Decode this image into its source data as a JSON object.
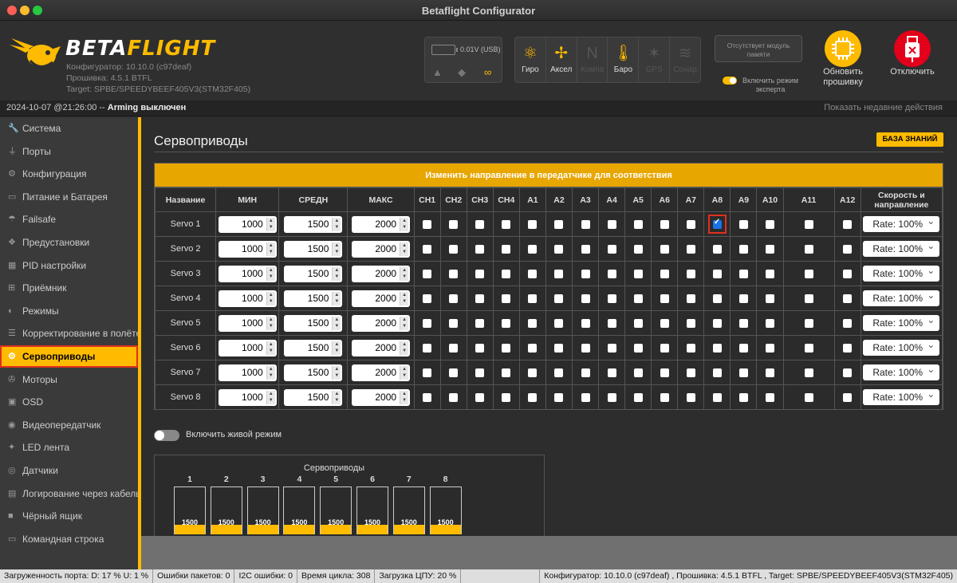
{
  "window": {
    "title": "Betaflight Configurator"
  },
  "header": {
    "logo_main": "BETA",
    "logo_accent": "FLIGHT",
    "configurator_version": "Конфигуратор: 10.10.0 (c97deaf)",
    "firmware_version": "Прошивка: 4.5.1 BTFL",
    "target": "Target: SPBE/SPEEDYBEEF405V3(STM32F405)",
    "battery_voltage": "0.01V (USB)",
    "sensors": [
      {
        "label": "Гиро",
        "icon": "gyro-icon",
        "active": true
      },
      {
        "label": "Аксел",
        "icon": "accel-icon",
        "active": true
      },
      {
        "label": "Компа",
        "icon": "compass-icon",
        "active": false
      },
      {
        "label": "Баро",
        "icon": "baro-icon",
        "active": true
      },
      {
        "label": "GPS",
        "icon": "gps-icon",
        "active": false
      },
      {
        "label": "Сонар",
        "icon": "sonar-icon",
        "active": false
      }
    ],
    "memory_status": "Отсутствует модуль памяти",
    "expert_mode_label": "Включить режим эксперта",
    "expert_mode_on": true,
    "flash_label": "Обновить прошивку",
    "disconnect_label": "Отключить",
    "accent_color": "#ffbb00",
    "disconnect_color": "#e2001a"
  },
  "logbar": {
    "timestamp": "2024-10-07 @21:26:00",
    "separator": " -- ",
    "message": "Arming выключен",
    "recent_actions": "Показать недавние действия"
  },
  "sidebar": {
    "items": [
      {
        "label": "Система",
        "icon": "wrench-icon"
      },
      {
        "label": "Порты",
        "icon": "plug-icon"
      },
      {
        "label": "Конфигурация",
        "icon": "gear-icon"
      },
      {
        "label": "Питание и Батарея",
        "icon": "battery-icon"
      },
      {
        "label": "Failsafe",
        "icon": "parachute-icon"
      },
      {
        "label": "Предустановки",
        "icon": "presets-icon"
      },
      {
        "label": "PID настройки",
        "icon": "pid-icon"
      },
      {
        "label": "Приёмник",
        "icon": "receiver-icon"
      },
      {
        "label": "Режимы",
        "icon": "toggle-icon"
      },
      {
        "label": "Корректирование в полёте",
        "icon": "sliders-icon"
      },
      {
        "label": "Сервоприводы",
        "icon": "servo-icon",
        "active": true
      },
      {
        "label": "Моторы",
        "icon": "motor-icon"
      },
      {
        "label": "OSD",
        "icon": "osd-icon"
      },
      {
        "label": "Видеопередатчик",
        "icon": "vtx-icon"
      },
      {
        "label": "LED лента",
        "icon": "led-icon"
      },
      {
        "label": "Датчики",
        "icon": "sensor-icon"
      },
      {
        "label": "Логирование через кабель",
        "icon": "log-icon"
      },
      {
        "label": "Чёрный ящик",
        "icon": "blackbox-icon"
      },
      {
        "label": "Командная строка",
        "icon": "terminal-icon"
      }
    ]
  },
  "page": {
    "title": "Сервоприводы",
    "wiki_button": "БАЗА ЗНАНИЙ",
    "table_banner": "Изменить направление в передатчике для соответствия",
    "columns": {
      "name": "Название",
      "min": "МИН",
      "mid": "СРЕДН",
      "max": "МАКС",
      "channels": [
        "CH1",
        "CH2",
        "CH3",
        "CH4",
        "A1",
        "A2",
        "A3",
        "A4",
        "A5",
        "A6",
        "A7",
        "A8",
        "A9",
        "A10",
        "A11",
        "A12"
      ],
      "rate": "Скорость и направление"
    },
    "servos": [
      {
        "name": "Servo 1",
        "min": "1000",
        "mid": "1500",
        "max": "2000",
        "checked": [
          11
        ],
        "rate": "Rate: 100%"
      },
      {
        "name": "Servo 2",
        "min": "1000",
        "mid": "1500",
        "max": "2000",
        "checked": [],
        "rate": "Rate: 100%"
      },
      {
        "name": "Servo 3",
        "min": "1000",
        "mid": "1500",
        "max": "2000",
        "checked": [],
        "rate": "Rate: 100%"
      },
      {
        "name": "Servo 4",
        "min": "1000",
        "mid": "1500",
        "max": "2000",
        "checked": [],
        "rate": "Rate: 100%"
      },
      {
        "name": "Servo 5",
        "min": "1000",
        "mid": "1500",
        "max": "2000",
        "checked": [],
        "rate": "Rate: 100%"
      },
      {
        "name": "Servo 6",
        "min": "1000",
        "mid": "1500",
        "max": "2000",
        "checked": [],
        "rate": "Rate: 100%"
      },
      {
        "name": "Servo 7",
        "min": "1000",
        "mid": "1500",
        "max": "2000",
        "checked": [],
        "rate": "Rate: 100%"
      },
      {
        "name": "Servo 8",
        "min": "1000",
        "mid": "1500",
        "max": "2000",
        "checked": [],
        "rate": "Rate: 100%"
      }
    ],
    "live_mode_label": "Включить живой режим",
    "live_mode_on": false,
    "bars_title": "Сервоприводы",
    "bars": [
      {
        "num": "1",
        "value": "1500",
        "level": 0.2
      },
      {
        "num": "2",
        "value": "1500",
        "level": 0.2
      },
      {
        "num": "3",
        "value": "1500",
        "level": 0.2
      },
      {
        "num": "4",
        "value": "1500",
        "level": 0.2
      },
      {
        "num": "5",
        "value": "1500",
        "level": 0.2
      },
      {
        "num": "6",
        "value": "1500",
        "level": 0.2
      },
      {
        "num": "7",
        "value": "1500",
        "level": 0.2
      },
      {
        "num": "8",
        "value": "1500",
        "level": 0.2
      }
    ]
  },
  "statusbar": {
    "port_load": "Загруженность порта: D: 17 % U: 1 %",
    "packet_errors": "Ошибки пакетов: 0",
    "i2c_errors": "I2C ошибки: 0",
    "cycle_time": "Время цикла: 308",
    "cpu_load": "Загрузка ЦПУ: 20 %",
    "versions": "Конфигуратор: 10.10.0 (c97deaf) , Прошивка: 4.5.1 BTFL , Target: SPBE/SPEEDYBEEF405V3(STM32F405)"
  }
}
